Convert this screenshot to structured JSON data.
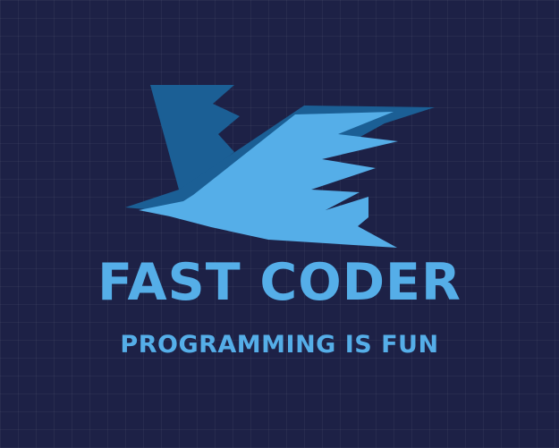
{
  "logo": {
    "brand_name": "FAST CODER",
    "tagline": "PROGRAMMING IS FUN",
    "icon": "bird-icon"
  },
  "colors": {
    "background": "#1d2146",
    "grid_line": "#2a2f58",
    "text": "#55aee8",
    "bird_light": "#55aee8",
    "bird_dark": "#1b5f95"
  }
}
